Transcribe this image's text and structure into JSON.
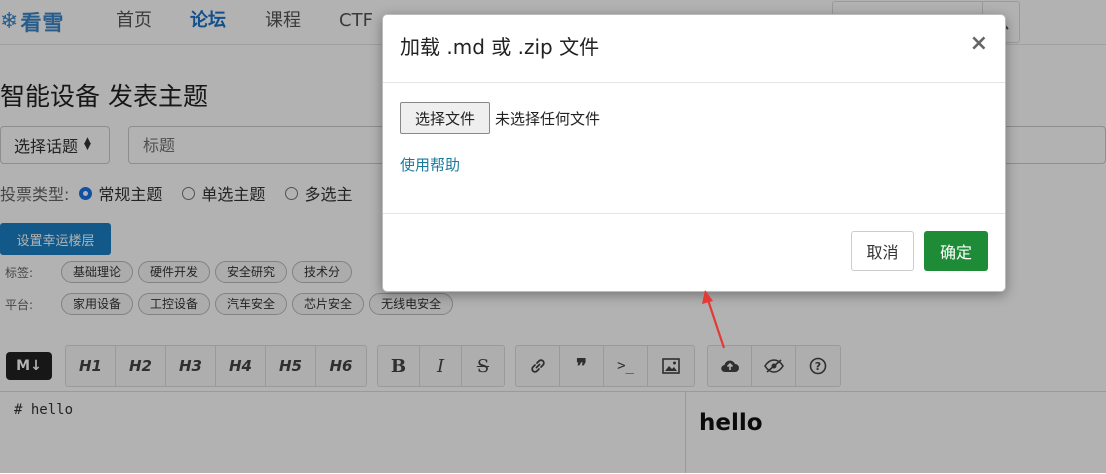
{
  "nav": {
    "logo_text": "看雪",
    "items": [
      {
        "label": "首页",
        "active": false
      },
      {
        "label": "论坛",
        "active": true
      },
      {
        "label": "课程",
        "active": false
      },
      {
        "label": "CTF",
        "active": false
      }
    ]
  },
  "page": {
    "title": "智能设备 发表主题",
    "topic_select": "选择话题",
    "title_placeholder": "标题",
    "vote": {
      "label": "投票类型:",
      "options": [
        {
          "label": "常规主题",
          "checked": true
        },
        {
          "label": "单选主题",
          "checked": false
        },
        {
          "label": "多选主",
          "checked": false
        }
      ]
    },
    "lucky_button": "设置幸运楼层",
    "tags": {
      "label": "标签:",
      "items": [
        "基础理论",
        "硬件开发",
        "安全研究",
        "技术分"
      ]
    },
    "platform": {
      "label": "平台:",
      "items": [
        "家用设备",
        "工控设备",
        "汽车安全",
        "芯片安全",
        "无线电安全"
      ]
    }
  },
  "editor": {
    "headings": [
      "H1",
      "H2",
      "H3",
      "H4",
      "H5",
      "H6"
    ],
    "content": "# hello",
    "preview_heading": "hello"
  },
  "modal": {
    "title": "加载 .md 或 .zip 文件",
    "close": "×",
    "file_button": "选择文件",
    "file_status": "未选择任何文件",
    "help_link": "使用帮助",
    "cancel": "取消",
    "confirm": "确定"
  },
  "colors": {
    "brand": "#1a73c9",
    "confirm_button": "#1e8c37",
    "lucky_button": "#1a80c4",
    "annotation_arrow": "#e53935"
  }
}
